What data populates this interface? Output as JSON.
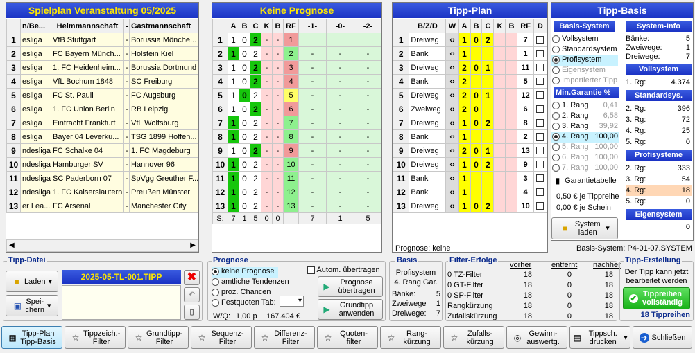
{
  "spielplan": {
    "title": "Spielplan Veranstaltung 05/2025",
    "headers": [
      "n/Be...",
      "Heimmannschaft",
      "-",
      "Gastmannschaft"
    ],
    "rows": [
      [
        "esliga",
        "VfB Stuttgart",
        "-",
        "Borussia Mönche..."
      ],
      [
        "esliga",
        "FC Bayern Münch...",
        "-",
        "Holstein Kiel"
      ],
      [
        "esliga",
        "1. FC Heidenheim...",
        "-",
        "Borussia Dortmund"
      ],
      [
        "esliga",
        "VfL Bochum 1848",
        "-",
        "SC Freiburg"
      ],
      [
        "esliga",
        "FC St. Pauli",
        "-",
        "FC Augsburg"
      ],
      [
        "esliga",
        "1. FC Union Berlin",
        "-",
        "RB Leipzig"
      ],
      [
        "esliga",
        "Eintracht Frankfurt",
        "-",
        "VfL Wolfsburg"
      ],
      [
        "esliga",
        "Bayer 04 Leverku...",
        "-",
        "TSG 1899 Hoffen..."
      ],
      [
        "ndesliga",
        "FC Schalke 04",
        "-",
        "1. FC Magdeburg"
      ],
      [
        "ndesliga",
        "Hamburger SV",
        "-",
        "Hannover 96"
      ],
      [
        "ndesliga",
        "SC Paderborn 07",
        "-",
        "SpVgg Greuther F..."
      ],
      [
        "ndesliga",
        "1. FC Kaiserslautern",
        "-",
        "Preußen Münster"
      ],
      [
        "er Lea...",
        "FC Arsenal",
        "-",
        "Manchester City"
      ]
    ]
  },
  "prognose_table": {
    "title": "Keine Prognose",
    "headers": [
      "A",
      "B",
      "C",
      "K",
      "B",
      "RF",
      "-1-",
      "-0-",
      "-2-"
    ],
    "rows": [
      [
        "1",
        "0",
        "2",
        "-",
        "-",
        "1",
        "",
        "",
        ""
      ],
      [
        "1",
        "0",
        "2",
        "-",
        "-",
        "2",
        "-",
        "-",
        "-"
      ],
      [
        "1",
        "0",
        "2",
        "-",
        "-",
        "3",
        "-",
        "-",
        "-"
      ],
      [
        "1",
        "0",
        "2",
        "-",
        "-",
        "4",
        "-",
        "-",
        "-"
      ],
      [
        "1",
        "0",
        "2",
        "-",
        "-",
        "5",
        "-",
        "-",
        "-"
      ],
      [
        "1",
        "0",
        "2",
        "-",
        "-",
        "6",
        "-",
        "-",
        "-"
      ],
      [
        "1",
        "0",
        "2",
        "-",
        "-",
        "7",
        "-",
        "-",
        "-"
      ],
      [
        "1",
        "0",
        "2",
        "-",
        "-",
        "8",
        "-",
        "-",
        "-"
      ],
      [
        "1",
        "0",
        "2",
        "-",
        "-",
        "9",
        "-",
        "-",
        "-"
      ],
      [
        "1",
        "0",
        "2",
        "-",
        "-",
        "10",
        "-",
        "-",
        "-"
      ],
      [
        "1",
        "0",
        "2",
        "-",
        "-",
        "11",
        "-",
        "-",
        "-"
      ],
      [
        "1",
        "0",
        "2",
        "-",
        "-",
        "12",
        "-",
        "-",
        "-"
      ],
      [
        "1",
        "0",
        "2",
        "-",
        "-",
        "13",
        "-",
        "-",
        "-"
      ]
    ],
    "hl": [
      2,
      0,
      2,
      2,
      1,
      2,
      0,
      0,
      2,
      0,
      0,
      0,
      0
    ],
    "sum": [
      "S:",
      "7",
      "1",
      "5",
      "0",
      "0",
      "",
      "7",
      "1",
      "5"
    ]
  },
  "tippplan": {
    "title": "Tipp-Plan",
    "headers": [
      "B/Z/D",
      "W",
      "A",
      "B",
      "C",
      "K",
      "B",
      "RF",
      "D"
    ],
    "rows": [
      [
        "Dreiweg",
        "‹›",
        "1",
        "0",
        "2",
        "7"
      ],
      [
        "Bank",
        "‹›",
        "1",
        "",
        "",
        "1"
      ],
      [
        "Dreiweg",
        "‹›",
        "2",
        "0",
        "1",
        "11"
      ],
      [
        "Bank",
        "‹›",
        "2",
        "",
        "",
        "5"
      ],
      [
        "Dreiweg",
        "‹›",
        "2",
        "0",
        "1",
        "12"
      ],
      [
        "Zweiweg",
        "‹›",
        "2",
        "0",
        "",
        "6"
      ],
      [
        "Dreiweg",
        "‹›",
        "1",
        "0",
        "2",
        "8"
      ],
      [
        "Bank",
        "‹›",
        "1",
        "",
        "",
        "2"
      ],
      [
        "Dreiweg",
        "‹›",
        "2",
        "0",
        "1",
        "13"
      ],
      [
        "Dreiweg",
        "‹›",
        "1",
        "0",
        "2",
        "9"
      ],
      [
        "Bank",
        "‹›",
        "1",
        "",
        "",
        "3"
      ],
      [
        "Bank",
        "‹›",
        "1",
        "",
        "",
        "4"
      ],
      [
        "Dreiweg",
        "‹›",
        "1",
        "0",
        "2",
        "10"
      ]
    ],
    "footer_left": "Prognose: keine",
    "footer_right": "Basis-System: P4-01-07.SYSTEM"
  },
  "tippbasis": {
    "title": "Tipp-Basis",
    "basis_system": "Basis-System",
    "systems": [
      "Vollsystem",
      "Standardsystem",
      "Profisystem",
      "Eigensystem",
      "Importierter Tipp"
    ],
    "min_garantie": "Min.Garantie  %",
    "ranks": [
      [
        "1. Rang",
        "0,41"
      ],
      [
        "2. Rang",
        "6,58"
      ],
      [
        "3. Rang",
        "39,92"
      ],
      [
        "4. Rang",
        "100,00"
      ],
      [
        "5. Rang",
        "100,00"
      ],
      [
        "6. Rang",
        "100,00"
      ],
      [
        "7. Rang",
        "100,00"
      ]
    ],
    "garantietabelle": "Garantietabelle",
    "preis1": "0,50 € je Tippreihe",
    "preis2": "0,00 € je Schein",
    "system_laden": "System laden",
    "sysinfo": "System-Info",
    "banke": [
      "Bänke:",
      "5"
    ],
    "zweiwege": [
      "Zweiwege:",
      "1"
    ],
    "dreiwege": [
      "Dreiwege:",
      "7"
    ],
    "vollsystem": "Vollsystem",
    "voll": [
      [
        "1. Rg:",
        "4.374"
      ]
    ],
    "standardsys": "Standardsys.",
    "std": [
      [
        "2. Rg:",
        "396"
      ],
      [
        "3. Rg:",
        "72"
      ],
      [
        "4. Rg:",
        "25"
      ],
      [
        "5. Rg:",
        "0"
      ]
    ],
    "profisysteme": "Profisysteme",
    "profi": [
      [
        "2. Rg:",
        "333"
      ],
      [
        "3. Rg:",
        "54"
      ],
      [
        "4. Rg:",
        "18"
      ],
      [
        "5. Rg:",
        "0"
      ]
    ],
    "eigensystem": "Eigensystem",
    "eigen": "0"
  },
  "tippdatei": {
    "title": "Tipp-Datei",
    "laden": "Laden",
    "speichern": "Spei-\nchern",
    "filename": "2025-05-TL-001.TIPP"
  },
  "prognose": {
    "title": "Prognose",
    "options": [
      "keine Prognose",
      "amtliche Tendenzen",
      "proz. Chancen",
      "Festquoten Tab:"
    ],
    "autom": "Autom. übertragen",
    "btn1": "Prognose übertragen",
    "btn2": "Grundtipp anwenden",
    "wq": "W/Q:",
    "wq_val": "1,00 p",
    "wq_eur": "167.404 €"
  },
  "basis": {
    "title": "Basis",
    "l1": "Profisystem",
    "l2": "4. Rang Gar.",
    "rows": [
      [
        "Bänke:",
        "5"
      ],
      [
        "Zweiwege",
        "1"
      ],
      [
        "Dreiwege:",
        "7"
      ]
    ]
  },
  "filter": {
    "title": "Filter-Erfolge",
    "cols": [
      "vorher",
      "entfernt",
      "nachher"
    ],
    "rows": [
      [
        "0  TZ-Filter",
        "18",
        "0",
        "18"
      ],
      [
        "0  GT-Filter",
        "18",
        "0",
        "18"
      ],
      [
        "0  SP-Filter",
        "18",
        "0",
        "18"
      ],
      [
        "Rangkürzung",
        "18",
        "0",
        "18"
      ],
      [
        "Zufallskürzung",
        "18",
        "0",
        "18"
      ]
    ]
  },
  "tipperstellung": {
    "title": "Tipp-Erstellung",
    "text": "Der Tipp kann jetzt bearbeitet werden",
    "btn": "Tippreihen vollständig",
    "count": "18 Tippreihen"
  },
  "toolbar": [
    "Tipp-Plan Tipp-Basis",
    "Tippzeich.- Filter",
    "Grundtipp- Filter",
    "Sequenz- Filter",
    "Differenz- Filter",
    "Quoten- filter",
    "Rang- kürzung",
    "Zufalls- kürzung",
    "Gewinn- auswertg.",
    "Tippsch. drucken",
    "Schließen"
  ]
}
